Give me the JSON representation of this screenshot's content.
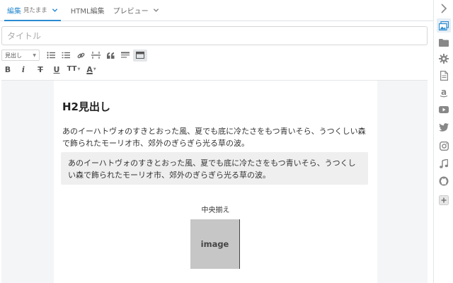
{
  "tabs": [
    {
      "label": "編集",
      "sub": "見たまま",
      "active": true
    },
    {
      "label": "HTML編集",
      "active": false
    },
    {
      "label": "プレビュー",
      "active": false
    }
  ],
  "title_input": {
    "placeholder": "タイトル",
    "value": ""
  },
  "toolbar": {
    "heading_select": "見出し",
    "bold": "B",
    "italic": "i",
    "strike": "T",
    "underline": "U",
    "font_size": "TT",
    "font_color": "A"
  },
  "content": {
    "h2": "H2見出し",
    "paragraph": "あのイーハトヴォのすきとおった風、夏でも底に冷たさをもつ青いそら、うつくしい森で飾られたモーリオ市、郊外のぎらぎら光る草の波。",
    "blockquote": "あのイーハトヴォのすきとおった風、夏でも底に冷たさをもつ青いそら、うつくしい森で飾られたモーリオ市、郊外のぎらぎら光る草の波。",
    "center_label": "中央揃え",
    "image_label": "image"
  },
  "sidebar": {
    "icons": [
      "chevron-right-icon",
      "image-icon",
      "folder-icon",
      "gear-icon",
      "document-icon",
      "amazon-icon",
      "youtube-icon",
      "twitter-icon",
      "instagram-icon",
      "music-icon",
      "github-icon",
      "plus-icon"
    ]
  },
  "colors": {
    "accent": "#2a8bd1",
    "icon_gray": "#888888",
    "sidebar_active_icon": "#2a8bd1"
  }
}
